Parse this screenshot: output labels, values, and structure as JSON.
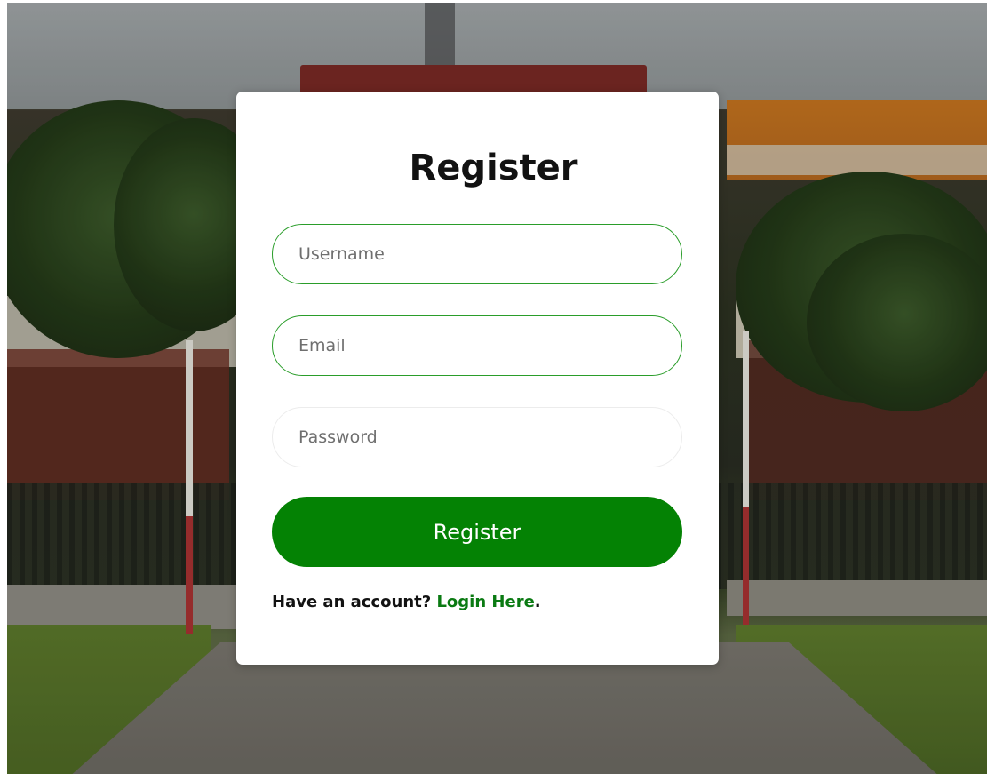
{
  "form": {
    "title": "Register",
    "username_placeholder": "Username",
    "email_placeholder": "Email",
    "password_placeholder": "Password",
    "submit_label": "Register"
  },
  "footer": {
    "prompt_text": "Have an account? ",
    "login_link": "Login Here",
    "trailing": "."
  },
  "colors": {
    "primary_green": "#048204",
    "link_green": "#0a7a12",
    "focus_border": "#2a9d2a"
  }
}
